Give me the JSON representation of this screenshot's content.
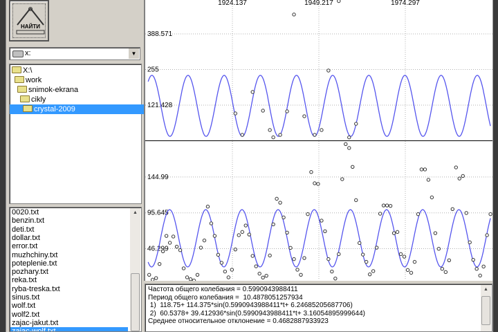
{
  "find_button": {
    "label": "НАЙТИ"
  },
  "drive_combo": {
    "value": "x:",
    "icon": "drive-icon"
  },
  "dir_tree": {
    "items": [
      {
        "label": "X:\\",
        "level": 0
      },
      {
        "label": "work",
        "level": 1
      },
      {
        "label": "snimok-ekrana",
        "level": 2
      },
      {
        "label": "cikly",
        "level": 3
      },
      {
        "label": "crystal-2009",
        "level": 4,
        "selected": true
      }
    ]
  },
  "file_list": {
    "items": [
      "0020.txt",
      "benzin.txt",
      "deti.txt",
      "dollar.txt",
      "error.txt",
      "muzhchiny.txt",
      "poteplenie.txt",
      "pozhary.txt",
      "reka.txt",
      "ryba-treska.txt",
      "sinus.txt",
      "wolf.txt",
      "wolf2.txt",
      "zajac-jakut.txt",
      "zajac-wolf.txt"
    ],
    "selected": "zajac-wolf.txt"
  },
  "memo": {
    "lines": [
      "Частота общего колебания = 0.5990943988411",
      "Период общего колебания =  10.4878051257934",
      " 1)  118.75+ 114.375*sin(0.5990943988411*t+ 6.24685205687706)",
      " 2)  60.5378+ 39.412936*sin(0.5990943988411*t+ 3.16054895999644)",
      "Среднее относительное отклонение = 0.4682887933923"
    ]
  },
  "colors": {
    "fit_curve": "#5555ee",
    "points": "#333333",
    "selection": "#3399ff",
    "grid": "#b0b0b0"
  },
  "chart_data": [
    {
      "type": "scatter",
      "title": "",
      "x_tick_labels": [
        "1924.137",
        "1949.217",
        "1974.297"
      ],
      "x_ticks": [
        1924.137,
        1949.217,
        1974.297
      ],
      "y_tick_labels": [
        "388.571",
        "255",
        "121.428"
      ],
      "y_ticks": [
        388.571,
        255,
        121.428
      ],
      "xlim": [
        1899.6,
        1999.0
      ],
      "ylim": [
        0,
        515
      ],
      "grid": true,
      "fit": {
        "mean": 118.75,
        "amplitude": 114.375,
        "frequency": 0.5990943988411,
        "phase": 6.24685205687706
      },
      "points": [
        [
          1925,
          90.3
        ],
        [
          1927,
          9.9
        ],
        [
          1930,
          170.7
        ],
        [
          1933,
          100.7
        ],
        [
          1935,
          28.1
        ],
        [
          1936,
          0.5
        ],
        [
          1938,
          9.9
        ],
        [
          1940,
          98.1
        ],
        [
          1942,
          461.2
        ],
        [
          1945,
          79.9
        ],
        [
          1948,
          9.9
        ],
        [
          1950,
          28.1
        ],
        [
          1952,
          251.1
        ],
        [
          1955,
          513
        ],
        [
          1958,
          0.5
        ],
        [
          1960,
          51.4
        ]
      ]
    },
    {
      "type": "scatter",
      "title": "",
      "y_tick_labels": [
        "144.99",
        "95.645",
        "46.299"
      ],
      "y_ticks": [
        144.99,
        95.645,
        46.299
      ],
      "xlim": [
        1899.6,
        1999.0
      ],
      "ylim": [
        2.8,
        194.2
      ],
      "grid": true,
      "fit": {
        "mean": 60.5378,
        "amplitude": 39.412936,
        "frequency": 0.5990943988411,
        "phase": 3.16054895999644
      },
      "x": [
        1900,
        1901,
        1902,
        1903,
        1904,
        1905,
        1906,
        1907,
        1908,
        1909,
        1910,
        1911,
        1912,
        1913,
        1914,
        1915,
        1916,
        1917,
        1918,
        1919,
        1920,
        1921,
        1922,
        1923,
        1924,
        1925,
        1926,
        1927,
        1928,
        1929,
        1930,
        1931,
        1932,
        1933,
        1934,
        1935,
        1936,
        1937,
        1938,
        1939,
        1940,
        1941,
        1942,
        1943,
        1944,
        1945,
        1946,
        1947,
        1948,
        1949,
        1950,
        1951,
        1952,
        1953,
        1954,
        1955,
        1956,
        1957,
        1958,
        1959,
        1960,
        1961,
        1962,
        1963,
        1964,
        1965,
        1966,
        1967,
        1968,
        1969,
        1970,
        1971,
        1972,
        1973,
        1974,
        1975,
        1976,
        1977,
        1978,
        1979,
        1980,
        1981,
        1982,
        1983,
        1984,
        1985,
        1986,
        1987,
        1988,
        1989,
        1990,
        1991,
        1992,
        1993,
        1994,
        1995,
        1996,
        1997,
        1998,
        1999
      ],
      "y": [
        10.3,
        3.6,
        5.8,
        25.2,
        42.7,
        63.9,
        54.4,
        63.0,
        49.0,
        44.2,
        19.2,
        6.8,
        4.2,
        2.4,
        10.3,
        47.7,
        57.6,
        104.2,
        81.1,
        63.9,
        37.9,
        26.8,
        14.8,
        6.8,
        17.3,
        45.2,
        64.9,
        69.3,
        78.2,
        65.8,
        36.3,
        22.0,
        11.9,
        6.5,
        9.0,
        36.9,
        79.8,
        115.0,
        109.6,
        89.3,
        68.4,
        47.4,
        31.9,
        17.3,
        10.3,
        33.4,
        93.8,
        151.8,
        136.3,
        135.4,
        84.9,
        70.3,
        31.9,
        14.8,
        5.2,
        38.8,
        142.0,
        190.3,
        184.9,
        158.9,
        113.1,
        54.1,
        38.2,
        28.1,
        10.9,
        15.4,
        47.7,
        94.4,
        105.8,
        105.8,
        105.2,
        67.7,
        69.3,
        38.8,
        35.3,
        16.9,
        13.1,
        28.1,
        93.8,
        155.4,
        155.4,
        141.1,
        116.9,
        67.7,
        46.1,
        18.5,
        14.1,
        30.3,
        100.8,
        158.2,
        142.9,
        146.4,
        95.4,
        55.0,
        30.9,
        18.5,
        9.3,
        21.7,
        64.9,
        93.8
      ]
    }
  ]
}
